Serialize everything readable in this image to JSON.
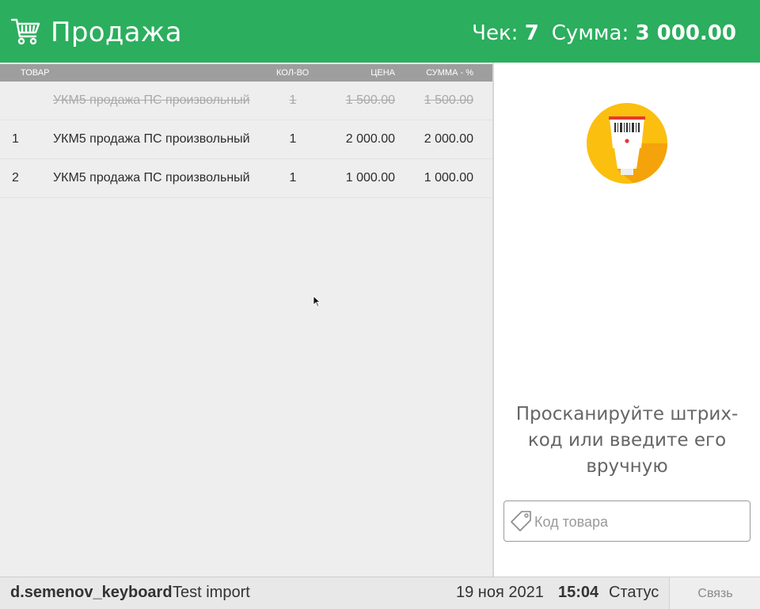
{
  "header": {
    "title": "Продажа",
    "receipt_label": "Чек:",
    "receipt_number": "7",
    "total_label": "Сумма:",
    "total_value": "3 000.00",
    "cart_icon": "shopping-cart-icon"
  },
  "table": {
    "columns": {
      "product": "ТОВАР",
      "qty": "КОЛ-ВО",
      "price": "ЦЕНА",
      "sum": "СУММА - %"
    },
    "rows": [
      {
        "num": "",
        "name": "УКМ5 продажа ПС произвольный",
        "qty": "1",
        "price": "1 500.00",
        "sum": "1 500.00",
        "deleted": true
      },
      {
        "num": "1",
        "name": "УКМ5 продажа ПС произвольный",
        "qty": "1",
        "price": "2 000.00",
        "sum": "2 000.00",
        "deleted": false
      },
      {
        "num": "2",
        "name": "УКМ5 продажа ПС произвольный",
        "qty": "1",
        "price": "1 000.00",
        "sum": "1 000.00",
        "deleted": false
      }
    ]
  },
  "scan": {
    "icon": "barcode-scanner-icon",
    "hint_line1": "Просканируйте штрих-",
    "hint_line2": "код или введите его",
    "hint_line3": "вручную",
    "input_placeholder": "Код товара",
    "input_value": "",
    "input_icon": "price-tag-icon"
  },
  "footer": {
    "user": "d.semenov_keyboard",
    "org": "Test import",
    "date": "19 ноя 2021",
    "time": "15:04",
    "status": "Статус",
    "link": "Связь"
  },
  "colors": {
    "header_bg": "#2bae5e",
    "scanner_circle": "#fbbf0f",
    "table_header_bg": "#9e9e9e"
  }
}
